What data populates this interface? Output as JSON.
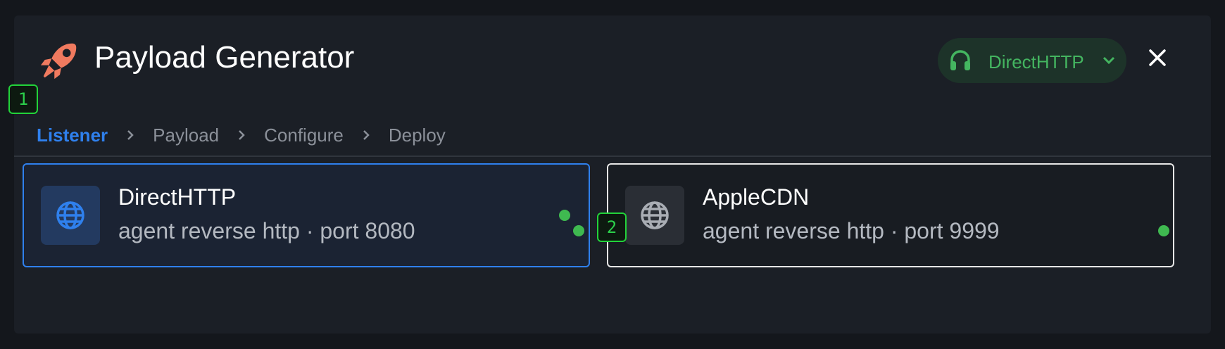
{
  "header": {
    "title": "Payload Generator",
    "icon": "rocket-icon",
    "listener_selector": {
      "label": "DirectHTTP",
      "icon": "headset-icon"
    },
    "close_icon": "close-icon"
  },
  "steps": [
    {
      "label": "Listener",
      "active": true
    },
    {
      "label": "Payload",
      "active": false
    },
    {
      "label": "Configure",
      "active": false
    },
    {
      "label": "Deploy",
      "active": false
    }
  ],
  "listeners": [
    {
      "name": "DirectHTTP",
      "description": "agent reverse http · port 8080",
      "selected": true,
      "status": "online"
    },
    {
      "name": "AppleCDN",
      "description": "agent reverse http · port 9999",
      "selected": false,
      "status": "online"
    }
  ],
  "badges": [
    "1",
    "2"
  ],
  "colors": {
    "accent": "#2f80ed",
    "status_green": "#3fb950",
    "rocket": "#f07a5f",
    "pill_text": "#44b560"
  }
}
